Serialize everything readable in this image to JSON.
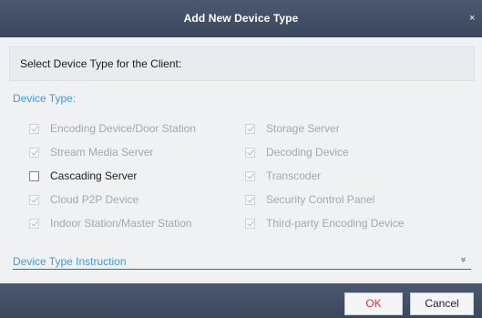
{
  "dialog": {
    "title": "Add New Device Type",
    "close_glyph": "×"
  },
  "prompt": "Select Device Type for the Client:",
  "device_type_label": "Device Type:",
  "device_types_left": [
    {
      "label": "Encoding Device/Door Station",
      "checked": true,
      "enabled": false
    },
    {
      "label": "Stream Media Server",
      "checked": true,
      "enabled": false
    },
    {
      "label": "Cascading Server",
      "checked": false,
      "enabled": true
    },
    {
      "label": "Cloud P2P Device",
      "checked": true,
      "enabled": false
    },
    {
      "label": "Indoor Station/Master Station",
      "checked": true,
      "enabled": false
    }
  ],
  "device_types_right": [
    {
      "label": "Storage Server",
      "checked": true,
      "enabled": false
    },
    {
      "label": "Decoding Device",
      "checked": true,
      "enabled": false
    },
    {
      "label": "Transcoder",
      "checked": true,
      "enabled": false
    },
    {
      "label": "Security Control Panel",
      "checked": true,
      "enabled": false
    },
    {
      "label": "Third-party Encoding Device",
      "checked": true,
      "enabled": false
    }
  ],
  "instruction": {
    "label": "Device Type Instruction",
    "expand_icon": "chevron-double-down-icon",
    "expand_glyph": "»"
  },
  "buttons": {
    "ok": "OK",
    "cancel": "Cancel"
  },
  "colors": {
    "titlebar": "#414e65",
    "link_blue": "#3c9ce6",
    "ok_text": "#e03030"
  }
}
